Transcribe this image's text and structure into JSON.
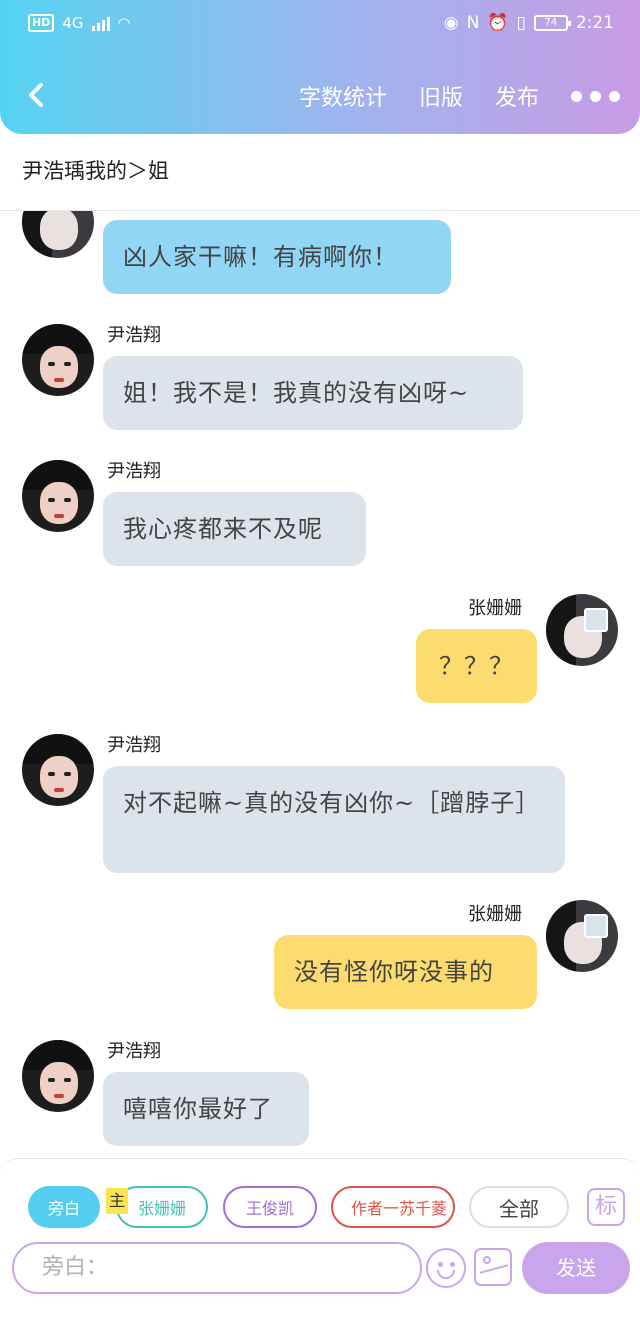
{
  "status_bar": {
    "left": [
      "HD",
      "4G"
    ],
    "time": "2:21",
    "battery": "74"
  },
  "header": {
    "actions": [
      "字数统计",
      "旧版",
      "发布"
    ]
  },
  "chapter_title": "尹浩瑀我的＞姐",
  "messages": [
    {
      "side": "left",
      "name": "",
      "text": "凶人家干嘛！有病啊你！",
      "color": "blue"
    },
    {
      "side": "left",
      "name": "尹浩翔",
      "text": "姐！我不是！我真的没有凶呀~",
      "color": "gray"
    },
    {
      "side": "left",
      "name": "尹浩翔",
      "text": "我心疼都来不及呢",
      "color": "gray"
    },
    {
      "side": "right",
      "name": "张姗姗",
      "text": "？？？",
      "color": "yellow"
    },
    {
      "side": "left",
      "name": "尹浩翔",
      "text": "对不起嘛~真的没有凶你~［蹭脖子］",
      "color": "gray"
    },
    {
      "side": "right",
      "name": "张姗姗",
      "text": "没有怪你呀没事的",
      "color": "yellow"
    },
    {
      "side": "left",
      "name": "尹浩翔",
      "text": "嘻嘻你最好了",
      "color": "gray"
    }
  ],
  "roles": {
    "narrator": "旁白",
    "main_tag": "主",
    "zhang": "张姗姗",
    "wang": "王俊凯",
    "author": "作者一苏千菱",
    "all": "全部",
    "tag": "标"
  },
  "input": {
    "placeholder": "旁白：",
    "send": "发送"
  }
}
